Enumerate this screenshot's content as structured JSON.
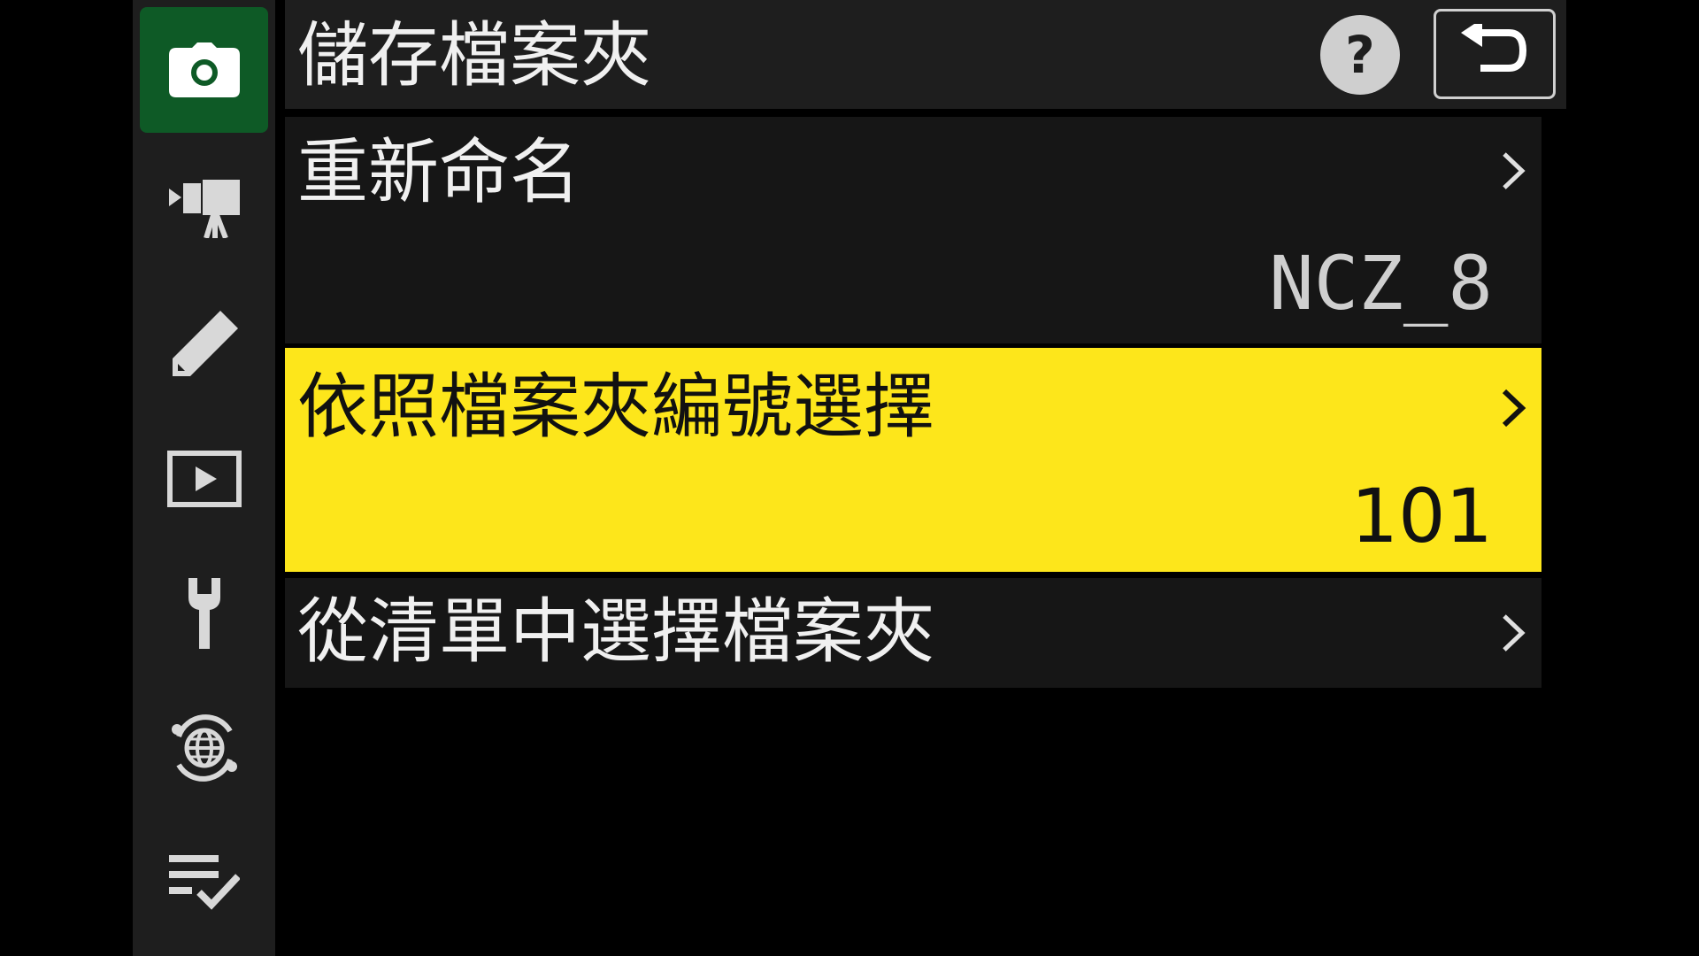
{
  "header": {
    "title": "儲存檔案夾",
    "help_label": "?"
  },
  "sidebar": {
    "items": [
      {
        "icon": "camera-icon",
        "active": true
      },
      {
        "icon": "movie-camera-icon",
        "active": false
      },
      {
        "icon": "pencil-icon",
        "active": false
      },
      {
        "icon": "playback-icon",
        "active": false
      },
      {
        "icon": "wrench-icon",
        "active": false
      },
      {
        "icon": "network-globe-icon",
        "active": false
      },
      {
        "icon": "my-menu-icon",
        "active": false
      }
    ]
  },
  "menu": {
    "items": [
      {
        "label": "重新命名",
        "value": "NCZ_8"
      },
      {
        "label": "依照檔案夾編號選擇",
        "value": "101"
      },
      {
        "label": "從清單中選擇檔案夾",
        "value": ""
      }
    ]
  },
  "colors": {
    "highlight": "#fde61b",
    "active_tab": "#0e5a26",
    "panel": "#1e1e1e",
    "row_bg": "#161616"
  }
}
